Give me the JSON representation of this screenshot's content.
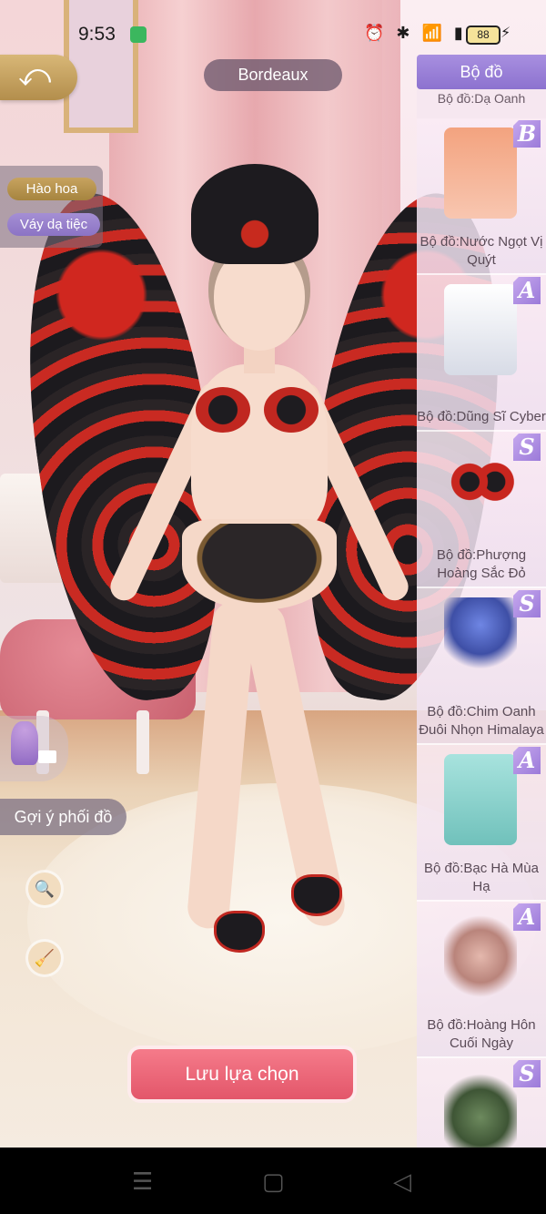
{
  "status_bar": {
    "time": "9:53",
    "icons": "⏰ ✱ 📶 ▮▮",
    "battery": "88",
    "charging": "⚡"
  },
  "header": {
    "back_icon": "back-arrow-icon",
    "title": "Bordeaux"
  },
  "tags": [
    "Hào hoa",
    "Váy dạ tiệc"
  ],
  "left_tools": {
    "suggest_label": "Gợi ý phối đồ",
    "search_icon": "🔍",
    "clean_icon": "🧹"
  },
  "save_label": "Lưu lựa chọn",
  "panel": {
    "title": "Bộ đồ",
    "previous_item_label": "Bộ đồ:Dạ Oanh",
    "items": [
      {
        "grade": "B",
        "label": "Bộ đồ:Nước Ngọt Vị Quýt",
        "color": "#f3a37f"
      },
      {
        "grade": "A",
        "label": "Bộ đồ:Dũng Sĩ Cyber",
        "color": "#e9ecf2"
      },
      {
        "grade": "S",
        "label": "Bộ đồ:Phượng Hoàng Sắc Đỏ",
        "color": "#c8261f"
      },
      {
        "grade": "S",
        "label": "Bộ đồ:Chim Oanh Đuôi Nhọn Himalaya",
        "color": "#5a72d6"
      },
      {
        "grade": "A",
        "label": "Bộ đồ:Bạc Hà Mùa Hạ",
        "color": "#8fd7d2"
      },
      {
        "grade": "A",
        "label": "Bộ đồ:Hoàng Hôn Cuối Ngày",
        "color": "#e4b8ad"
      },
      {
        "grade": "S",
        "label": "",
        "color": "#6d8a5e"
      }
    ]
  },
  "nav_bar": {
    "menu": "☰",
    "home": "▢",
    "back": "◁"
  }
}
